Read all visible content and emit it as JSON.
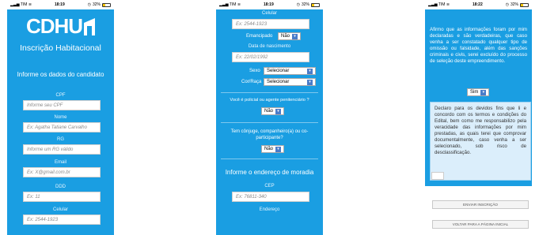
{
  "status": {
    "carrier": "TIM",
    "battery": "32%",
    "times": [
      "18:19",
      "18:19",
      "18:22"
    ]
  },
  "screen1": {
    "logo_text": "CDHU",
    "app_title": "Inscrição Habitacional",
    "section_title": "Informe os dados do candidato",
    "cpf_label": "CPF",
    "cpf_placeholder": "Informe seu CPF",
    "nome_label": "Nome",
    "nome_placeholder": "Ex: Agatha Tatiane Carvalho",
    "rg_label": "RG",
    "rg_placeholder": "Informe um RG válido",
    "email_label": "Email",
    "email_placeholder": "Ex: X@gmail.com.br",
    "ddd_label": "DDD",
    "ddd_placeholder": "Ex: 11",
    "celular_label": "Celular",
    "celular_placeholder": "Ex: 2544-1923"
  },
  "screen2": {
    "celular_label": "Celular",
    "celular_placeholder": "Ex: 2544-1923",
    "emancipado_label": "Emancipado",
    "emancipado_value": "Não",
    "nascimento_label": "Data de nascimento",
    "nascimento_placeholder": "Ex: 22/02/1992",
    "sexo_label": "Sexo",
    "sexo_value": "Selecionar",
    "cor_label": "Cor/Raça",
    "cor_value": "Selecionar",
    "policial_question": "Você é policial ou agente penitenciário ?",
    "policial_value": "Não",
    "conjuge_question": "Tem cônjuge, companheiro(a) ou co-participante?",
    "conjuge_value": "Não",
    "endereco_title": "Informe o endereço de moradia",
    "cep_label": "CEP",
    "cep_placeholder": "Ex: 76811-340",
    "endereco_label": "Endereço"
  },
  "screen3": {
    "affirm_text": "Afirmo que as informações foram por mim declaradas e são verdadeiras, que caso venha a ser constatado qualquer tipo de omissão ou falsidade, além das sanções criminais e civis, serei excluído do processo de seleção deste empreendimento.",
    "affirm_value": "Sim",
    "declaration_text": "Declaro para os devidos fins que li e concordo com os termos e condições do Edital, bem como me responsabilizo pela veracidade das informações por mim prestadas, as quais terei que comprovar documentalmente, caso venha a ser selecionado, sob risco de desclassificação.",
    "submit_button": "ENVIAR INSCRIÇÃO",
    "back_button": "VOLTAR PARA A PÁGINA INICIAL"
  },
  "colors": {
    "brand_blue": "#1a9ee2",
    "select_arrow": "#4a7cc9"
  },
  "icons": {
    "signal": "signal-icon",
    "wifi": "wifi-icon",
    "battery": "battery-icon",
    "dropdown": "chevron-down-icon"
  }
}
